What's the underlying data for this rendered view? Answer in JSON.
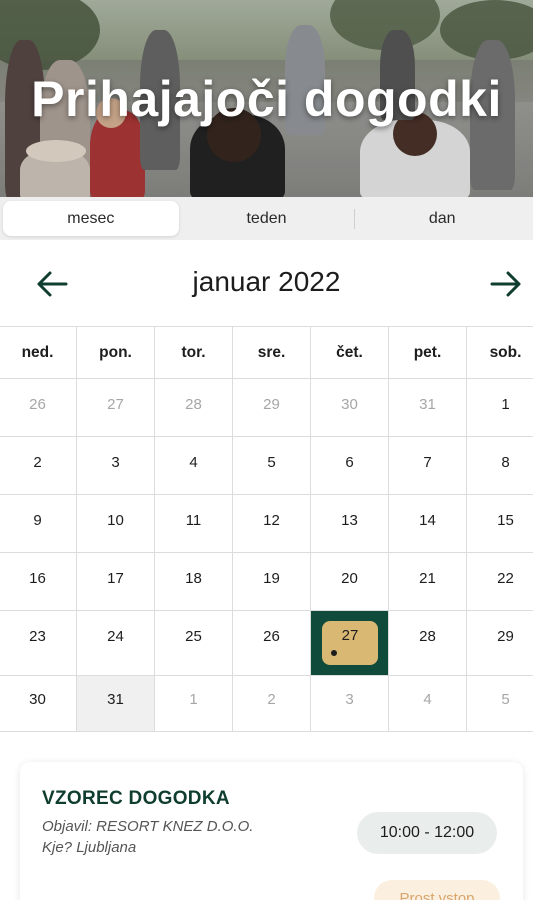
{
  "hero": {
    "title": "Prihajajoči dogodki"
  },
  "view_tabs": [
    {
      "label": "mesec",
      "active": true
    },
    {
      "label": "teden",
      "active": false
    },
    {
      "label": "dan",
      "active": false
    }
  ],
  "calendar": {
    "month_label": "januar 2022",
    "prev_icon": "arrow-left-icon",
    "next_icon": "arrow-right-icon",
    "weekdays": [
      "ned.",
      "pon.",
      "tor.",
      "sre.",
      "čet.",
      "pet.",
      "sob."
    ],
    "weeks": [
      [
        "26",
        "27",
        "28",
        "29",
        "30",
        "31",
        "1"
      ],
      [
        "2",
        "3",
        "4",
        "5",
        "6",
        "7",
        "8"
      ],
      [
        "9",
        "10",
        "11",
        "12",
        "13",
        "14",
        "15"
      ],
      [
        "16",
        "17",
        "18",
        "19",
        "20",
        "21",
        "22"
      ],
      [
        "23",
        "24",
        "25",
        "26",
        "27",
        "28",
        "29"
      ],
      [
        "30",
        "31",
        "1",
        "2",
        "3",
        "4",
        "5"
      ]
    ],
    "selected_day": "27",
    "accent_color": "#0f4a3a",
    "badge_color": "#d9b873"
  },
  "event": {
    "title": "VZOREC DOGODKA",
    "published_by": "Objavil: RESORT KNEZ D.O.O.",
    "location": "Kje? Ljubljana",
    "time": "10:00 - 12:00",
    "availability": "Prost vstop"
  }
}
